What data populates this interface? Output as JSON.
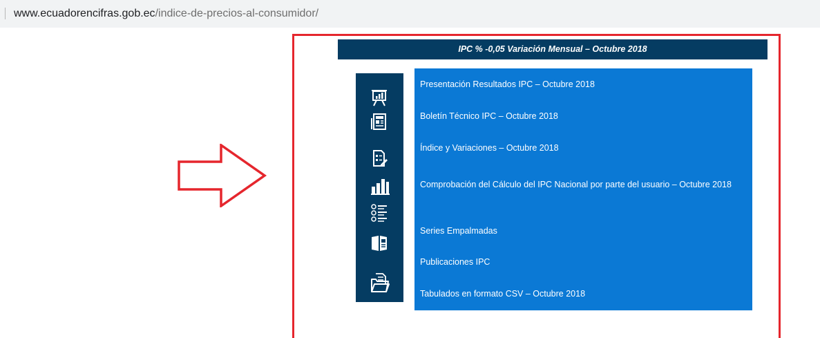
{
  "address_bar": {
    "domain": "www.ecuadorencifras.gob.ec",
    "path": "/indice-de-precios-al-consumidor/"
  },
  "banner": {
    "title": "IPC % -0,05 Variación Mensual – Octubre 2018"
  },
  "icons": [
    "presentation-icon",
    "newspaper-icon",
    "document-edit-icon",
    "bar-chart-icon",
    "checklist-icon",
    "book-icon",
    "folder-files-icon"
  ],
  "links": [
    "Presentación Resultados IPC – Octubre 2018",
    "Boletín Técnico IPC – Octubre 2018",
    "Índice y Variaciones – Octubre 2018",
    "Comprobación del Cálculo del IPC Nacional por parte del usuario – Octubre 2018",
    "Series Empalmadas",
    "Publicaciones IPC",
    "Tabulados en formato CSV – Octubre 2018"
  ],
  "colors": {
    "navy": "#053c62",
    "blue": "#0b79d5",
    "annotation_red": "#e5262d"
  }
}
